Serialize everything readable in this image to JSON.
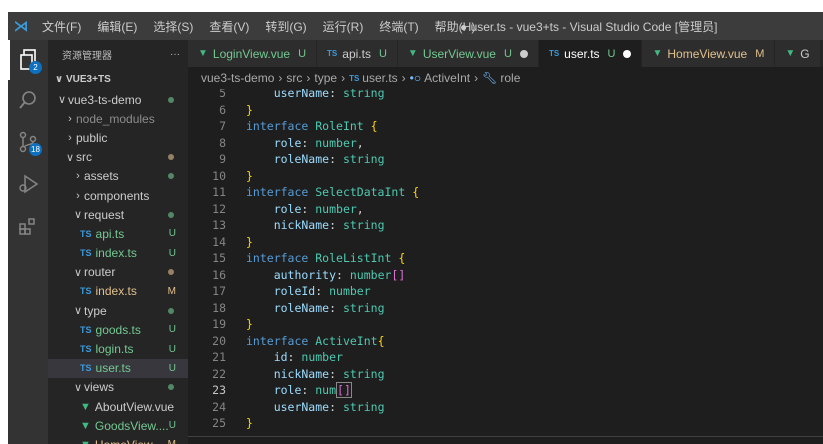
{
  "titlebar": {
    "menu": [
      "文件(F)",
      "编辑(E)",
      "选择(S)",
      "查看(V)",
      "转到(G)",
      "运行(R)",
      "终端(T)",
      "帮助(H)"
    ],
    "window_title": "● user.ts - vue3+ts - Visual Studio Code [管理员]"
  },
  "activity": {
    "scm_badge": "18",
    "explorer_badge": "2"
  },
  "sidebar": {
    "title": "资源管理器",
    "more": "···",
    "workspace": "VUE3+TS",
    "rows": [
      {
        "label": "vue3-ts-demo",
        "kind": "folder",
        "open": true,
        "indent": 0,
        "status": "dot-green"
      },
      {
        "label": "node_modules",
        "kind": "folder",
        "open": false,
        "indent": 1,
        "status": "",
        "dim": true
      },
      {
        "label": "public",
        "kind": "folder",
        "open": false,
        "indent": 1,
        "status": ""
      },
      {
        "label": "src",
        "kind": "folder",
        "open": true,
        "indent": 1,
        "status": "dot-mod"
      },
      {
        "label": "assets",
        "kind": "folder",
        "open": false,
        "indent": 2,
        "status": "dot-green"
      },
      {
        "label": "components",
        "kind": "folder",
        "open": false,
        "indent": 2,
        "status": ""
      },
      {
        "label": "request",
        "kind": "folder",
        "open": true,
        "indent": 2,
        "status": "dot-green"
      },
      {
        "label": "api.ts",
        "kind": "ts",
        "indent": 3,
        "status": "U"
      },
      {
        "label": "index.ts",
        "kind": "ts",
        "indent": 3,
        "status": "U"
      },
      {
        "label": "router",
        "kind": "folder",
        "open": true,
        "indent": 2,
        "status": "dot-mod"
      },
      {
        "label": "index.ts",
        "kind": "ts",
        "indent": 3,
        "status": "M"
      },
      {
        "label": "type",
        "kind": "folder",
        "open": true,
        "indent": 2,
        "status": "dot-green"
      },
      {
        "label": "goods.ts",
        "kind": "ts",
        "indent": 3,
        "status": "U"
      },
      {
        "label": "login.ts",
        "kind": "ts",
        "indent": 3,
        "status": "U"
      },
      {
        "label": "user.ts",
        "kind": "ts",
        "indent": 3,
        "status": "U",
        "selected": true
      },
      {
        "label": "views",
        "kind": "folder",
        "open": true,
        "indent": 2,
        "status": "dot-green"
      },
      {
        "label": "AboutView.vue",
        "kind": "vue",
        "indent": 3,
        "status": ""
      },
      {
        "label": "GoodsView....",
        "kind": "vue",
        "indent": 3,
        "status": "U"
      },
      {
        "label": "HomeView...",
        "kind": "vue",
        "indent": 3,
        "status": "M"
      }
    ]
  },
  "tabs": [
    {
      "label": "LoginView.vue",
      "icon": "vue",
      "status": "U",
      "active": false
    },
    {
      "label": "api.ts",
      "icon": "ts",
      "status": "U",
      "active": false
    },
    {
      "label": "UserView.vue",
      "icon": "vue",
      "status": "U",
      "dot": true,
      "active": false
    },
    {
      "label": "user.ts",
      "icon": "ts",
      "status": "U",
      "dot": true,
      "active": true
    },
    {
      "label": "HomeView.vue",
      "icon": "vue",
      "status": "M",
      "active": false
    },
    {
      "label": "G",
      "icon": "vue",
      "status": "",
      "active": false
    }
  ],
  "breadcrumb": {
    "parts": [
      "vue3-ts-demo",
      "src",
      "type"
    ],
    "file": "user.ts",
    "symbol1": "ActiveInt",
    "symbol2": "role"
  },
  "editor": {
    "current_line": 23,
    "lines": [
      {
        "n": "5",
        "tokens": [
          [
            "pr",
            "    userName"
          ],
          [
            "pu",
            ": "
          ],
          [
            "ty",
            "string"
          ]
        ]
      },
      {
        "n": "6",
        "tokens": [
          [
            "br",
            "}"
          ]
        ]
      },
      {
        "n": "7",
        "tokens": [
          [
            "kw",
            "interface"
          ],
          [
            "pu",
            " "
          ],
          [
            "ty",
            "RoleInt"
          ],
          [
            "pu",
            " "
          ],
          [
            "br",
            "{"
          ]
        ]
      },
      {
        "n": "8",
        "tokens": [
          [
            "pr",
            "    role"
          ],
          [
            "pu",
            ": "
          ],
          [
            "ty",
            "number"
          ],
          [
            "pu",
            ","
          ]
        ]
      },
      {
        "n": "9",
        "tokens": [
          [
            "pr",
            "    roleName"
          ],
          [
            "pu",
            ": "
          ],
          [
            "ty",
            "string"
          ]
        ]
      },
      {
        "n": "10",
        "tokens": [
          [
            "br",
            "}"
          ]
        ]
      },
      {
        "n": "11",
        "tokens": [
          [
            "kw",
            "interface"
          ],
          [
            "pu",
            " "
          ],
          [
            "ty",
            "SelectDataInt"
          ],
          [
            "pu",
            " "
          ],
          [
            "br",
            "{"
          ]
        ]
      },
      {
        "n": "12",
        "tokens": [
          [
            "pr",
            "    role"
          ],
          [
            "pu",
            ": "
          ],
          [
            "ty",
            "number"
          ],
          [
            "pu",
            ","
          ]
        ]
      },
      {
        "n": "13",
        "tokens": [
          [
            "pr",
            "    nickName"
          ],
          [
            "pu",
            ": "
          ],
          [
            "ty",
            "string"
          ]
        ]
      },
      {
        "n": "14",
        "tokens": [
          [
            "br",
            "}"
          ]
        ]
      },
      {
        "n": "15",
        "tokens": [
          [
            "kw",
            "interface"
          ],
          [
            "pu",
            " "
          ],
          [
            "ty",
            "RoleListInt"
          ],
          [
            "pu",
            " "
          ],
          [
            "br",
            "{"
          ]
        ]
      },
      {
        "n": "16",
        "tokens": [
          [
            "pr",
            "    authority"
          ],
          [
            "pu",
            ": "
          ],
          [
            "ty",
            "number"
          ],
          [
            "br2",
            "[]"
          ]
        ]
      },
      {
        "n": "17",
        "tokens": [
          [
            "pr",
            "    roleId"
          ],
          [
            "pu",
            ": "
          ],
          [
            "ty",
            "number"
          ]
        ]
      },
      {
        "n": "18",
        "tokens": [
          [
            "pr",
            "    roleName"
          ],
          [
            "pu",
            ": "
          ],
          [
            "ty",
            "string"
          ]
        ]
      },
      {
        "n": "19",
        "tokens": [
          [
            "br",
            "}"
          ]
        ]
      },
      {
        "n": "20",
        "tokens": [
          [
            "kw",
            "interface"
          ],
          [
            "pu",
            " "
          ],
          [
            "ty",
            "ActiveInt"
          ],
          [
            "br",
            "{"
          ]
        ]
      },
      {
        "n": "21",
        "tokens": [
          [
            "pr",
            "    id"
          ],
          [
            "pu",
            ": "
          ],
          [
            "ty",
            "number"
          ]
        ]
      },
      {
        "n": "22",
        "tokens": [
          [
            "pr",
            "    nickName"
          ],
          [
            "pu",
            ": "
          ],
          [
            "ty",
            "string"
          ]
        ]
      },
      {
        "n": "23",
        "tokens": [
          [
            "pr",
            "    role"
          ],
          [
            "pu",
            ": "
          ],
          [
            "ty",
            "num"
          ],
          [
            "br2",
            "[]"
          ]
        ]
      },
      {
        "n": "24",
        "tokens": [
          [
            "pr",
            "    userName"
          ],
          [
            "pu",
            ": "
          ],
          [
            "ty",
            "string"
          ]
        ]
      },
      {
        "n": "25",
        "tokens": [
          [
            "br",
            "}"
          ]
        ]
      }
    ]
  },
  "colors": {
    "accent": "#0e70c0",
    "untracked": "#73c991",
    "modified": "#e2c08d",
    "ts": "#3b9bdc",
    "vue": "#42b883"
  }
}
